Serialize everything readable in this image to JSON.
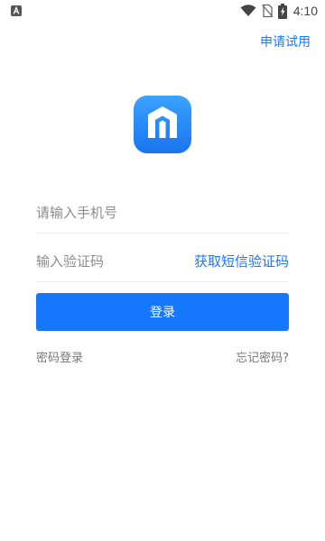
{
  "status_bar": {
    "time": "4:10",
    "icons": [
      "notification-a-icon",
      "wifi-icon",
      "no-sim-icon",
      "battery-charging-icon"
    ]
  },
  "header": {
    "trial_label": "申请试用"
  },
  "logo": {
    "icon": "app-logo-icon",
    "colors": {
      "top": "#3aa2ff",
      "bottom": "#1a74ee"
    }
  },
  "form": {
    "phone_placeholder": "请输入手机号",
    "phone_value": "",
    "code_placeholder": "输入验证码",
    "code_value": "",
    "get_code_label": "获取短信验证码",
    "login_label": "登录"
  },
  "footer_links": {
    "password_login": "密码登录",
    "forgot_password": "忘记密码?"
  },
  "colors": {
    "accent": "#1677ff",
    "placeholder": "#8c8c8c",
    "divider": "#ececec",
    "secondary_text": "#777777"
  }
}
